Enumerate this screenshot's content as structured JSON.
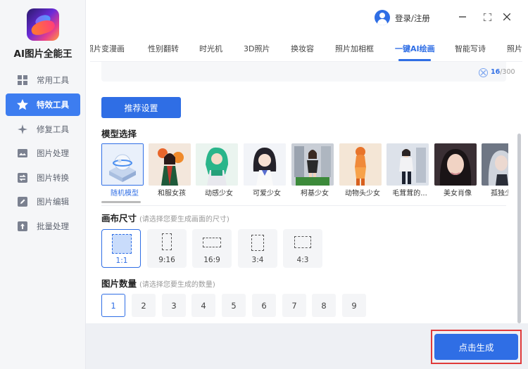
{
  "app": {
    "name": "AI图片全能王"
  },
  "sidebar": {
    "items": [
      {
        "label": "常用工具",
        "icon": "grid-icon",
        "active": false
      },
      {
        "label": "特效工具",
        "icon": "star-icon",
        "active": true
      },
      {
        "label": "修复工具",
        "icon": "sparkle-icon",
        "active": false
      },
      {
        "label": "图片处理",
        "icon": "image-icon",
        "active": false
      },
      {
        "label": "图片转换",
        "icon": "convert-icon",
        "active": false
      },
      {
        "label": "图片编辑",
        "icon": "edit-icon",
        "active": false
      },
      {
        "label": "批量处理",
        "icon": "upload-icon",
        "active": false
      }
    ]
  },
  "titlebar": {
    "login_label": "登录/注册"
  },
  "tabs": [
    {
      "label": "照片变漫画"
    },
    {
      "label": "性别翻转"
    },
    {
      "label": "时光机"
    },
    {
      "label": "3D照片"
    },
    {
      "label": "换妆容"
    },
    {
      "label": "照片加相框"
    },
    {
      "label": "一键AI绘画",
      "active": true
    },
    {
      "label": "智能写诗"
    },
    {
      "label": "照片"
    }
  ],
  "prompt": {
    "count": "16",
    "max": "/300"
  },
  "recommend_button": "推荐设置",
  "model_section": {
    "title": "模型选择",
    "models": [
      {
        "label": "随机模型",
        "selected": true
      },
      {
        "label": "和服女孩"
      },
      {
        "label": "动感少女"
      },
      {
        "label": "可爱少女"
      },
      {
        "label": "柯基少女"
      },
      {
        "label": "动物头少女"
      },
      {
        "label": "毛茸茸的..."
      },
      {
        "label": "美女肖像"
      },
      {
        "label": "孤独少女"
      }
    ]
  },
  "canvas_section": {
    "title": "画布尺寸",
    "hint": "(请选择您要生成画面的尺寸)",
    "ratios": [
      {
        "label": "1:1",
        "selected": true
      },
      {
        "label": "9:16"
      },
      {
        "label": "16:9"
      },
      {
        "label": "3:4"
      },
      {
        "label": "4:3"
      }
    ]
  },
  "count_section": {
    "title": "图片数量",
    "hint": "(请选择您要生成的数量)",
    "options": [
      "1",
      "2",
      "3",
      "4",
      "5",
      "6",
      "7",
      "8",
      "9"
    ],
    "selected": "1"
  },
  "generate_button": "点击生成",
  "colors": {
    "accent": "#2f6ee5",
    "highlight_frame": "#e03a3a"
  }
}
